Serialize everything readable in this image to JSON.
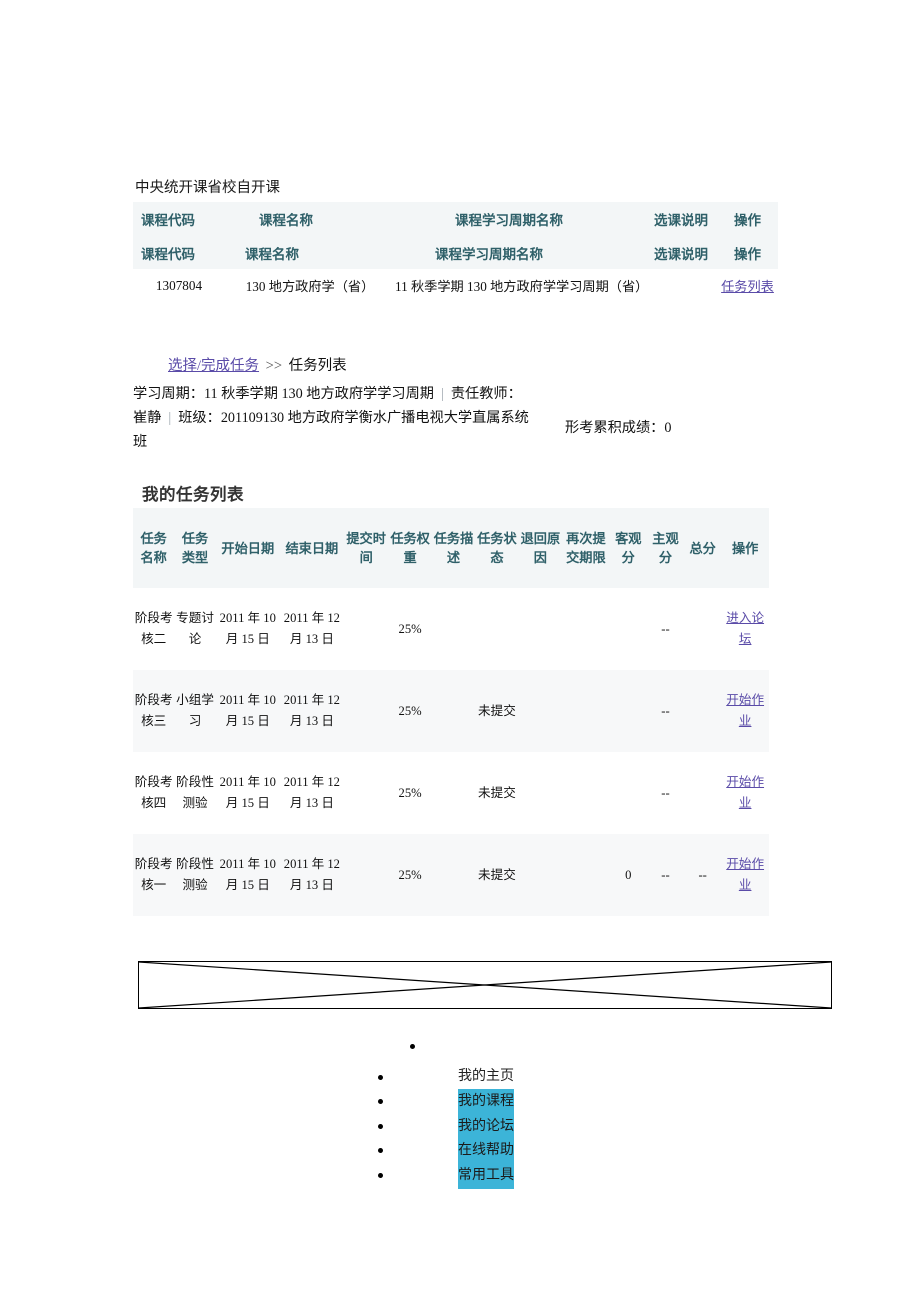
{
  "course_section": {
    "caption": "中央统开课省校自开课",
    "header_primary": [
      "课程代码",
      "课程名称",
      "课程学习周期名称",
      "选课说明",
      "操作"
    ],
    "header_secondary": [
      "课程代码",
      "课程名称",
      "课程学习周期名称",
      "选课说明",
      "操作"
    ],
    "rows": [
      {
        "code": "1307804",
        "name": "130 地方政府学（省）",
        "cycle": "11 秋季学期 130 地方政府学学习周期（省）",
        "desc": "",
        "action": "任务列表"
      }
    ]
  },
  "breadcrumb": {
    "link": "选择/完成任务",
    "separator": ">>",
    "current": "任务列表"
  },
  "cycle_info": {
    "line": "学习周期：11 秋季学期 130 地方政府学学习周期",
    "teacher": "责任教师：崔静",
    "class_label": "班级：",
    "class_value": "201109130 地方政府学衡水广播电视大学直属系统班"
  },
  "score": {
    "text": "形考累积成绩：0"
  },
  "task_list": {
    "title": "我的任务列表",
    "columns": [
      "任务名称",
      "任务类型",
      "开始日期",
      "结束日期",
      "提交时间",
      "任务权重",
      "任务描述",
      "任务状态",
      "退回原因",
      "再次提交期限",
      "客观分",
      "主观分",
      "总分",
      "操作"
    ],
    "rows": [
      {
        "name": "阶段考核二",
        "type": "专题讨论",
        "start": "2011 年 10 月 15 日",
        "end": "2011 年 12 月 13 日",
        "submit_time": "",
        "weight": "25%",
        "description": "",
        "status": "",
        "return_reason": "",
        "redeadline": "",
        "objective": "",
        "subjective": "--",
        "total": "",
        "action": "进入论坛"
      },
      {
        "name": "阶段考核三",
        "type": "小组学习",
        "start": "2011 年 10 月 15 日",
        "end": "2011 年 12 月 13 日",
        "submit_time": "",
        "weight": "25%",
        "description": "",
        "status": "未提交",
        "return_reason": "",
        "redeadline": "",
        "objective": "",
        "subjective": "--",
        "total": "",
        "action": "开始作业"
      },
      {
        "name": "阶段考核四",
        "type": "阶段性测验",
        "start": "2011 年 10 月 15 日",
        "end": "2011 年 12 月 13 日",
        "submit_time": "",
        "weight": "25%",
        "description": "",
        "status": "未提交",
        "return_reason": "",
        "redeadline": "",
        "objective": "",
        "subjective": "--",
        "total": "",
        "action": "开始作业"
      },
      {
        "name": "阶段考核一",
        "type": "阶段性测验",
        "start": "2011 年 10 月 15 日",
        "end": "2011 年 12 月 13 日",
        "submit_time": "",
        "weight": "25%",
        "description": "",
        "status": "未提交",
        "return_reason": "",
        "redeadline": "",
        "objective": "0",
        "subjective": "--",
        "total": "--",
        "action": "开始作业"
      }
    ]
  },
  "broken_image": {
    "alt": ""
  },
  "bottom_menu": {
    "items": [
      {
        "label": "",
        "highlighted": false
      },
      {
        "label": "我的主页",
        "highlighted": false
      },
      {
        "label": "我的课程",
        "highlighted": true
      },
      {
        "label": "我的论坛",
        "highlighted": true
      },
      {
        "label": "在线帮助",
        "highlighted": true
      },
      {
        "label": "常用工具",
        "highlighted": true
      }
    ]
  },
  "colors": {
    "table_header_bg": "#f3f6f7",
    "table_header_text": "#2f6069",
    "link": "#5a4ba8",
    "menu_highlight": "#3cb4d8",
    "row_alt_bg": "#f7f8f9"
  }
}
